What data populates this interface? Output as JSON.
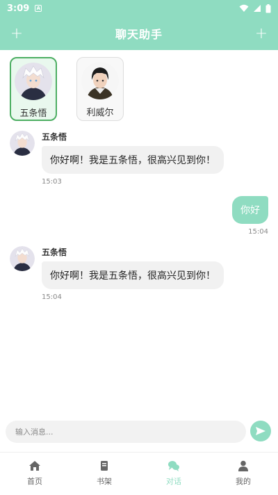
{
  "status_bar": {
    "time": "3:09"
  },
  "header": {
    "title": "聊天助手"
  },
  "characters": [
    {
      "name": "五条悟",
      "active": true
    },
    {
      "name": "利威尔",
      "active": false
    }
  ],
  "messages": [
    {
      "side": "left",
      "sender": "五条悟",
      "text": "你好啊！我是五条悟，很高兴见到你！",
      "time": "15:03"
    },
    {
      "side": "right",
      "text": "你好",
      "time": "15:04"
    },
    {
      "side": "left",
      "sender": "五条悟",
      "text": "你好啊！我是五条悟，很高兴见到你！",
      "time": "15:04"
    }
  ],
  "input": {
    "placeholder": "输入消息..."
  },
  "nav": [
    {
      "label": "首页",
      "icon": "home-icon",
      "active": false
    },
    {
      "label": "书架",
      "icon": "book-icon",
      "active": false
    },
    {
      "label": "对话",
      "icon": "chat-icon",
      "active": true
    },
    {
      "label": "我的",
      "icon": "person-icon",
      "active": false
    }
  ],
  "colors": {
    "accent": "#8fdcc1",
    "active_border": "#4cae62"
  }
}
